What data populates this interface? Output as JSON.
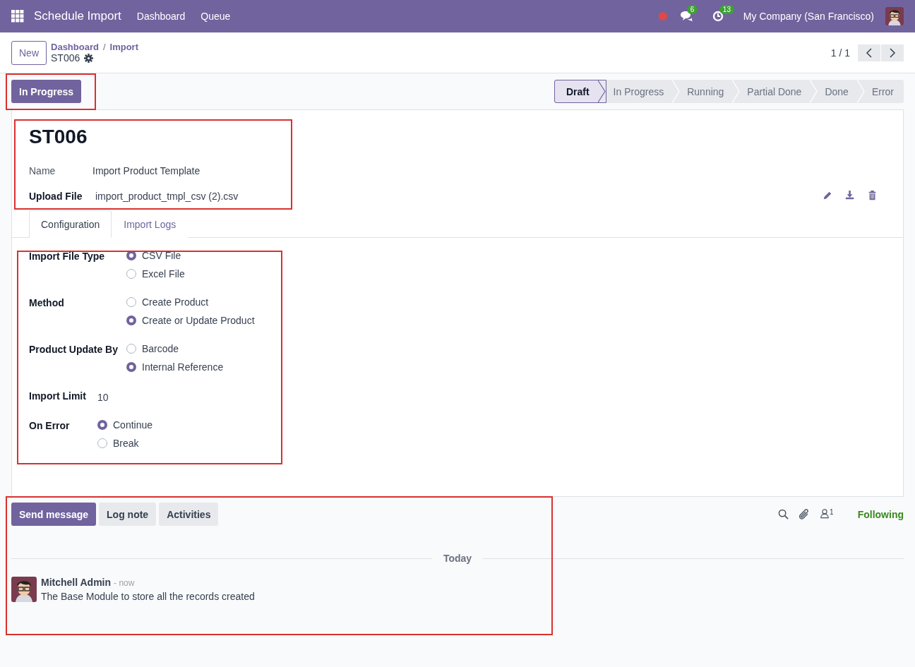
{
  "navbar": {
    "app_title": "Schedule Import",
    "menu": [
      "Dashboard",
      "Queue"
    ],
    "badges": [
      {
        "kind": "chat",
        "count": "6"
      },
      {
        "kind": "activity",
        "count": "13"
      }
    ],
    "company": "My Company (San Francisco)"
  },
  "control_panel": {
    "new_button": "New",
    "breadcrumb": [
      "Dashboard",
      "Import"
    ],
    "breadcrumb_separator": "/",
    "record": "ST006",
    "pager": "1 / 1"
  },
  "header": {
    "buttons": [
      "In Progress"
    ],
    "stages": [
      {
        "label": "Draft",
        "selected": true
      },
      {
        "label": "In Progress",
        "selected": false
      },
      {
        "label": "Running",
        "selected": false
      },
      {
        "label": "Partial Done",
        "selected": false
      },
      {
        "label": "Done",
        "selected": false
      },
      {
        "label": "Error",
        "selected": false
      }
    ]
  },
  "form": {
    "title": "ST006",
    "fields": [
      {
        "label": "Name",
        "value": "Import Product Template",
        "kind": "readonly"
      },
      {
        "label": "Upload File",
        "value": "import_product_tmpl_csv (2).csv",
        "kind": "file"
      }
    ],
    "tabs": [
      {
        "label": "Configuration",
        "selected": true
      },
      {
        "label": "Import Logs",
        "selected": false
      }
    ],
    "config_groups": [
      [
        {
          "label": "Import File Type",
          "kind": "radio",
          "options": [
            {
              "label": "CSV File",
              "selected": true
            },
            {
              "label": "Excel File",
              "selected": false
            }
          ]
        },
        {
          "label": "Method",
          "kind": "radio",
          "options": [
            {
              "label": "Create Product",
              "selected": false
            },
            {
              "label": "Create or Update Product",
              "selected": true
            }
          ]
        },
        {
          "label": "Product Update By",
          "kind": "radio",
          "options": [
            {
              "label": "Barcode",
              "selected": false
            },
            {
              "label": "Internal Reference",
              "selected": true
            }
          ]
        }
      ],
      [
        {
          "label": "Import Limit",
          "kind": "value",
          "value": "10"
        },
        {
          "label": "On Error",
          "kind": "radio",
          "options": [
            {
              "label": "Continue",
              "selected": true
            },
            {
              "label": "Break",
              "selected": false
            }
          ]
        }
      ]
    ]
  },
  "chatter": {
    "buttons": [
      {
        "label": "Send message",
        "selected": true
      },
      {
        "label": "Log note",
        "selected": false
      },
      {
        "label": "Activities",
        "selected": false
      }
    ],
    "followers_count": "1",
    "follow_label": "Following",
    "separator": "Today",
    "messages": [
      {
        "author": "Mitchell Admin",
        "time": "- now",
        "body": "The Base Module to store all the records created"
      }
    ]
  }
}
